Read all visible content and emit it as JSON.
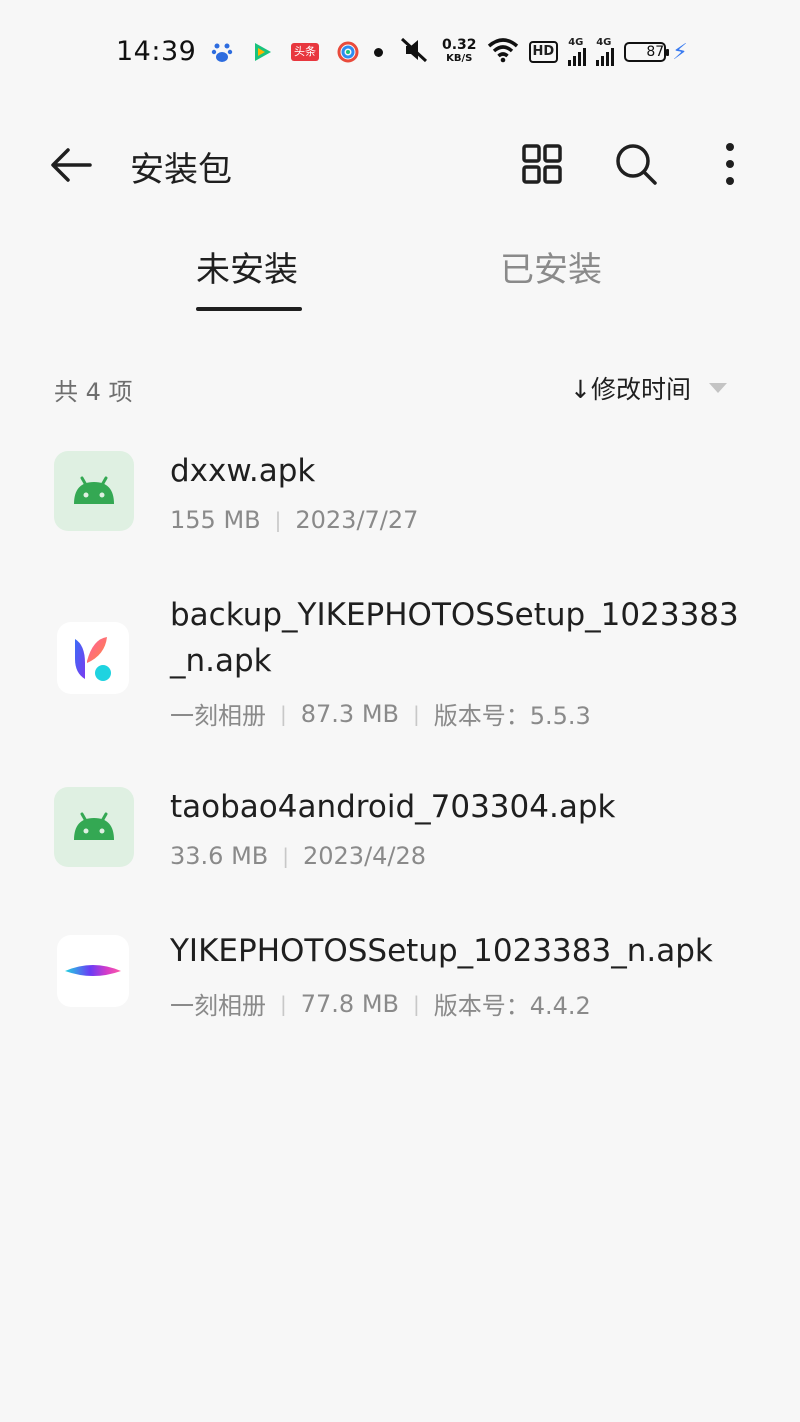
{
  "status_bar": {
    "time": "14:39",
    "toutiao_label": "头条",
    "net_speed_value": "0.32",
    "net_speed_unit": "KB/S",
    "hd_label": "HD",
    "signal1_label": "4G",
    "signal2_label": "4G",
    "battery_level": "87",
    "icons": [
      "baidu-icon",
      "video-icon",
      "toutiao-icon",
      "camera-app-icon",
      "mute-icon",
      "wifi-icon",
      "charging-icon"
    ],
    "battery_color": "#9fbef5",
    "charging_color": "#3a7bf0"
  },
  "app_bar": {
    "title": "安装包",
    "icons": [
      "back-arrow-icon",
      "grid-view-icon",
      "search-icon",
      "more-vert-icon"
    ]
  },
  "tabs": [
    {
      "label": "未安装",
      "active": true
    },
    {
      "label": "已安装",
      "active": false
    }
  ],
  "list_header": {
    "count": "共 4 项",
    "sort_label": "↓修改时间"
  },
  "files": [
    {
      "name": "dxxw.apk",
      "size": "155 MB",
      "date": "2023/7/27",
      "icon": "android-icon"
    },
    {
      "name": "backup_YIKEPHOTOSSetup_1023383",
      "name_line2": "_n.apk",
      "app": "一刻相册",
      "size": "87.3 MB",
      "version": "版本号：5.5.3",
      "icon": "yike-logo-icon"
    },
    {
      "name": "taobao4android_703304.apk",
      "size": "33.6 MB",
      "date": "2023/4/28",
      "icon": "android-icon"
    },
    {
      "name": "YIKEPHOTOSSetup_1023383_n.apk",
      "app": "一刻相册",
      "size": "77.8 MB",
      "version": "版本号：4.4.2",
      "icon": "yike-leaf-icon"
    }
  ],
  "colors": {
    "android_green": "#34a853",
    "android_bg": "#dff0e2",
    "text_primary": "#1f1f1f",
    "text_secondary": "#8a8a8a"
  }
}
